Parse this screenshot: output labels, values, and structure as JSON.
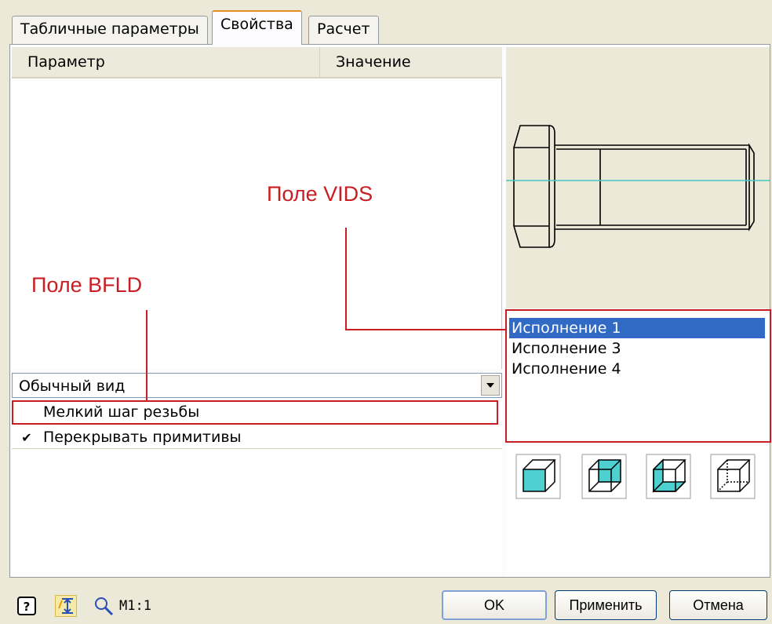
{
  "tabs": [
    "Табличные параметры",
    "Свойства",
    "Расчет"
  ],
  "table": {
    "col_param": "Параметр",
    "col_value": "Значение"
  },
  "view_select": {
    "value": "Обычный вид"
  },
  "checks": [
    {
      "label": "Мелкий шаг резьбы",
      "checked": false
    },
    {
      "label": "Перекрывать примитивы",
      "checked": true
    }
  ],
  "variants": [
    "Исполнение 1",
    "Исполнение 3",
    "Исполнение 4"
  ],
  "selected_variant": 0,
  "annotations": {
    "vids": "Поле VIDS",
    "bfld": "Поле BFLD"
  },
  "bottom": {
    "scale": "M1:1",
    "ok": "OK",
    "apply": "Применить",
    "cancel": "Отмена"
  },
  "colors": {
    "annotation": "#c81e23",
    "selection": "#316ac5",
    "axis_line": "#40c8c0",
    "cube_fill": "#4fd0d0"
  },
  "icons": [
    "help-icon",
    "dimension-toggle-icon",
    "zoom-icon",
    "cube-front-face-icon",
    "cube-top-face-icon",
    "cube-inner-face-icon",
    "cube-wireframe-icon",
    "dropdown-arrow-icon",
    "checkmark-icon"
  ]
}
